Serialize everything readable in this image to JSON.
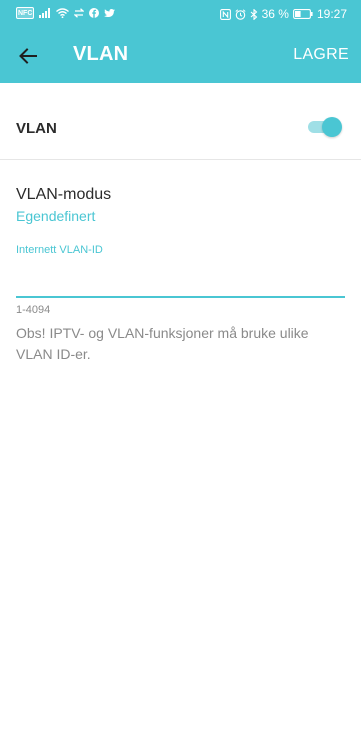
{
  "status_bar": {
    "left_icons": [
      "nfc-icon",
      "signal-icon",
      "wifi-icon",
      "transfer-icon",
      "facebook-icon",
      "twitter-icon"
    ],
    "nfc_badge": "NFC",
    "battery_percent": "36 %",
    "time": "19:27",
    "right_icons": [
      "nfc-n-icon",
      "alarm-icon",
      "bluetooth-icon",
      "battery-icon"
    ]
  },
  "appbar": {
    "back_icon": "arrow-left-icon",
    "title": "VLAN",
    "save_label": "LAGRE"
  },
  "vlan_toggle": {
    "label": "VLAN",
    "enabled": true
  },
  "vlan_mode": {
    "label": "VLAN-modus",
    "value": "Egendefinert"
  },
  "internet_vlan_id": {
    "label": "Internett VLAN-ID",
    "value": "",
    "placeholder": "",
    "hint": "1-4094"
  },
  "note": "Obs! IPTV- og VLAN-funksjoner må bruke ulike VLAN ID-er.",
  "colors": {
    "accent": "#4ac6d3",
    "text_primary": "#2b2b2b",
    "text_secondary": "#8a8a8a"
  }
}
